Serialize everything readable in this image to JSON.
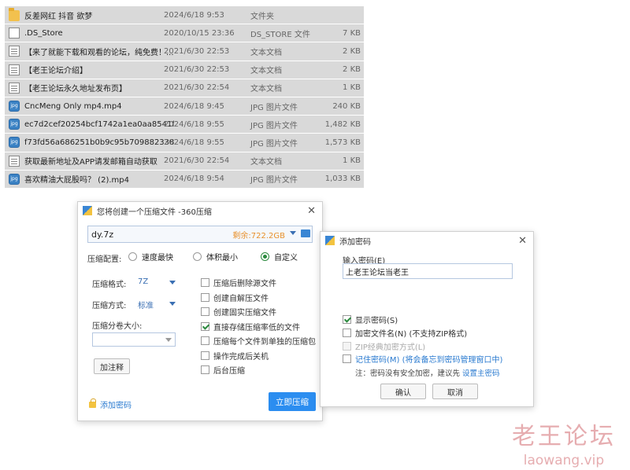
{
  "files": [
    {
      "icon": "folder",
      "name": "反差网红 抖音 欲梦",
      "date": "2024/6/18 9:53",
      "type": "文件夹",
      "size": ""
    },
    {
      "icon": "doc",
      "name": ".DS_Store",
      "date": "2020/10/15 23:36",
      "type": "DS_STORE 文件",
      "size": "7 KB"
    },
    {
      "icon": "txt",
      "name": "【来了就能下载和观看的论坛，纯免费！...",
      "date": "2021/6/30 22:53",
      "type": "文本文档",
      "size": "2 KB"
    },
    {
      "icon": "txt",
      "name": "【老王论坛介绍】",
      "date": "2021/6/30 22:53",
      "type": "文本文档",
      "size": "2 KB"
    },
    {
      "icon": "txt",
      "name": "【老王论坛永久地址发布页】",
      "date": "2021/6/30 22:54",
      "type": "文本文档",
      "size": "1 KB"
    },
    {
      "icon": "img",
      "name": "CncMeng Only mp4.mp4",
      "date": "2024/6/18 9:45",
      "type": "JPG 图片文件",
      "size": "240 KB"
    },
    {
      "icon": "img",
      "name": "ec7d2cef20254bcf1742a1ea0aa8541f...",
      "date": "2024/6/18 9:55",
      "type": "JPG 图片文件",
      "size": "1,482 KB"
    },
    {
      "icon": "img",
      "name": "f73fd56a686251b0b9c95b709882338...",
      "date": "2024/6/18 9:55",
      "type": "JPG 图片文件",
      "size": "1,573 KB"
    },
    {
      "icon": "txt",
      "name": "获取最新地址及APP请发邮箱自动获取",
      "date": "2021/6/30 22:54",
      "type": "文本文档",
      "size": "1 KB"
    },
    {
      "icon": "img",
      "name": "喜欢精油大屁股吗？ (2).mp4",
      "date": "2024/6/18 9:54",
      "type": "JPG 图片文件",
      "size": "1,033 KB"
    }
  ],
  "compress_dialog": {
    "title": "您将创建一个压缩文件 -360压缩",
    "close": "✕",
    "filename": "dy.7z",
    "remaining": "剩余:722.2GB",
    "config_label": "压缩配置:",
    "options": [
      "速度最快",
      "体积最小",
      "自定义"
    ],
    "selected_option": 2,
    "format_label": "压缩格式:",
    "format_value": "7Z",
    "method_label": "压缩方式:",
    "method_value": "标准",
    "split_label": "压缩分卷大小:",
    "comment_button": "加注释",
    "checkboxes": [
      {
        "label": "压缩后删除源文件",
        "checked": false
      },
      {
        "label": "创建自解压文件",
        "checked": false
      },
      {
        "label": "创建固实压缩文件",
        "checked": false
      },
      {
        "label": "直接存储压缩率低的文件",
        "checked": true
      },
      {
        "label": "压缩每个文件到单独的压缩包",
        "checked": false
      },
      {
        "label": "操作完成后关机",
        "checked": false
      },
      {
        "label": "后台压缩",
        "checked": false
      }
    ],
    "add_password_link": "添加密码",
    "start_button": "立即压缩"
  },
  "password_dialog": {
    "title": "添加密码",
    "close": "✕",
    "input_label": "输入密码(E)",
    "password_value": "上老王论坛当老王",
    "checkboxes": [
      {
        "label": "显示密码(S)",
        "checked": true,
        "disabled": false
      },
      {
        "label": "加密文件名(N) (不支持ZIP格式)",
        "checked": false,
        "disabled": false
      },
      {
        "label": "ZIP经典加密方式(L)",
        "checked": false,
        "disabled": true
      },
      {
        "label": "记住密码(M) (将会备忘到密码管理窗口中)",
        "checked": false,
        "disabled": false
      }
    ],
    "note_text": "注：密码没有安全加密，建议先 ",
    "note_link": "设置主密码",
    "ok_button": "确认",
    "cancel_button": "取消"
  },
  "watermark": {
    "title": "老王论坛",
    "url": "laowang.vip"
  }
}
